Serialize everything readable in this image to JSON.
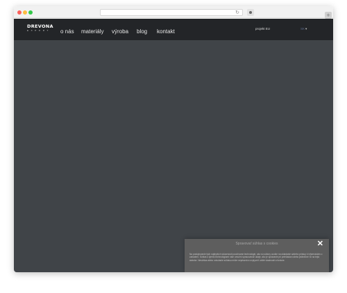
{
  "browser": {
    "reload_glyph": "↻",
    "new_tab_glyph": "+"
  },
  "navbar": {
    "logo_main": "DREVONA",
    "logo_sub": "EXPORT",
    "items": [
      {
        "label": "o nás"
      },
      {
        "label": "materiály"
      },
      {
        "label": "výroba"
      },
      {
        "label": "blog"
      },
      {
        "label": "kontakt"
      }
    ],
    "project_label": "projekt EU",
    "language": "SK",
    "language_caret": "▾"
  },
  "cookie": {
    "title": "Spravovať súhlas s cookies",
    "close_glyph": "✕",
    "text": "Na poskytovanie tých najlepších skúseností používame technológie, ako sú súbory cookie na ukladanie a/alebo prístup k informáciám o zariadení. Súhlas s týmito technológiami nám umožní spracovávať údaje, ako je správanie pri prehliadaní alebo jedinečné ID na tejto stránke. Nesúhlas alebo odvolanie súhlasu môže nepriaznivo ovplyvniť určité vlastnosti a funkcie."
  },
  "colors": {
    "navbar_bg": "#232528",
    "hero_bg": "#404448",
    "cookie_bg": "#5e5e5e",
    "language_link": "#5a6a8a"
  }
}
